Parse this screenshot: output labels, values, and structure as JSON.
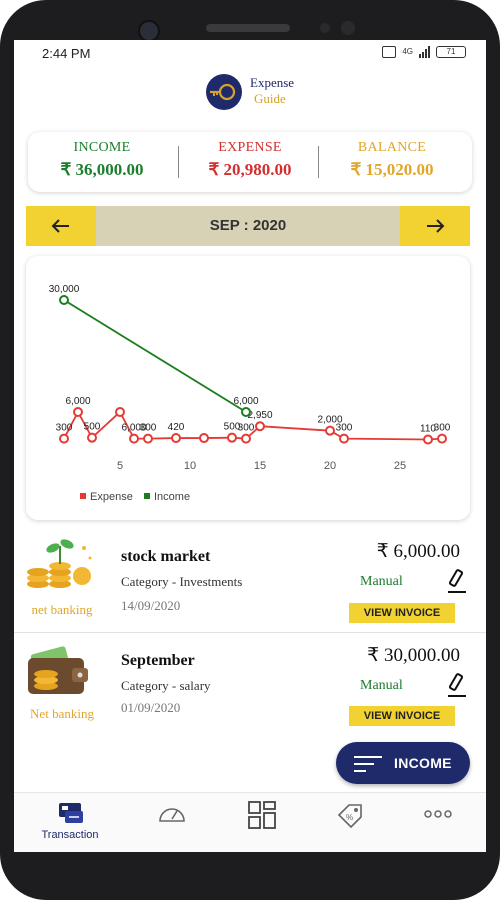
{
  "status_bar": {
    "time": "2:44 PM",
    "network": "4G",
    "battery": "71"
  },
  "app": {
    "logo_line1": "Expense",
    "logo_line2": "Guide"
  },
  "summary": {
    "income_label": "INCOME",
    "income_value": "₹ 36,000.00",
    "expense_label": "EXPENSE",
    "expense_value": "₹ 20,980.00",
    "balance_label": "BALANCE",
    "balance_value": "₹ 15,020.00",
    "colors": {
      "income": "#1c7d2d",
      "expense": "#d32f2f",
      "balance": "#e0a62a"
    }
  },
  "month_nav": {
    "label": "SEP : 2020",
    "prev_icon": "arrow-left-icon",
    "next_icon": "arrow-right-icon"
  },
  "chart_data": {
    "type": "line",
    "x_ticks": [
      5,
      10,
      15,
      20,
      25
    ],
    "xlim": [
      0,
      29
    ],
    "ylim": [
      0,
      30000
    ],
    "grid": false,
    "legend_position": "bottom-left",
    "series": [
      {
        "name": "Expense",
        "color": "#e53935",
        "x": [
          1,
          2,
          3,
          5,
          6,
          7,
          9,
          11,
          13,
          14,
          15,
          20,
          21,
          27,
          28
        ],
        "y": [
          300,
          6000,
          500,
          6000,
          300,
          300,
          420,
          420,
          500,
          300,
          2950,
          2000,
          300,
          110,
          300
        ],
        "labels": [
          "300",
          "6,000",
          "500",
          "",
          "6,000",
          "300",
          "420",
          "",
          "500",
          "300",
          "2,950",
          "2,000",
          "300",
          "110",
          "300"
        ]
      },
      {
        "name": "Income",
        "color": "#1b7d1e",
        "x": [
          1,
          14
        ],
        "y": [
          30000,
          6000
        ],
        "labels": [
          "30,000",
          "6,000"
        ]
      }
    ]
  },
  "transactions": [
    {
      "title": "stock market",
      "category": "Category - Investments",
      "date": "14/09/2020",
      "amount": "₹ 6,000.00",
      "type": "Manual",
      "method": "net banking",
      "invoice_label": "VIEW INVOICE",
      "icon": "money-plant-icon"
    },
    {
      "title": "September",
      "category": "Category - salary",
      "date": "01/09/2020",
      "amount": "₹ 30,000.00",
      "type": "Manual",
      "method": "Net banking",
      "invoice_label": "VIEW INVOICE",
      "icon": "wallet-icon"
    }
  ],
  "fab": {
    "label": "INCOME"
  },
  "bottom_nav": [
    {
      "label": "Transaction",
      "icon": "transaction-icon"
    },
    {
      "label": "",
      "icon": "speedometer-icon"
    },
    {
      "label": "",
      "icon": "grid-icon"
    },
    {
      "label": "",
      "icon": "tag-icon"
    },
    {
      "label": "",
      "icon": "more-icon"
    }
  ]
}
